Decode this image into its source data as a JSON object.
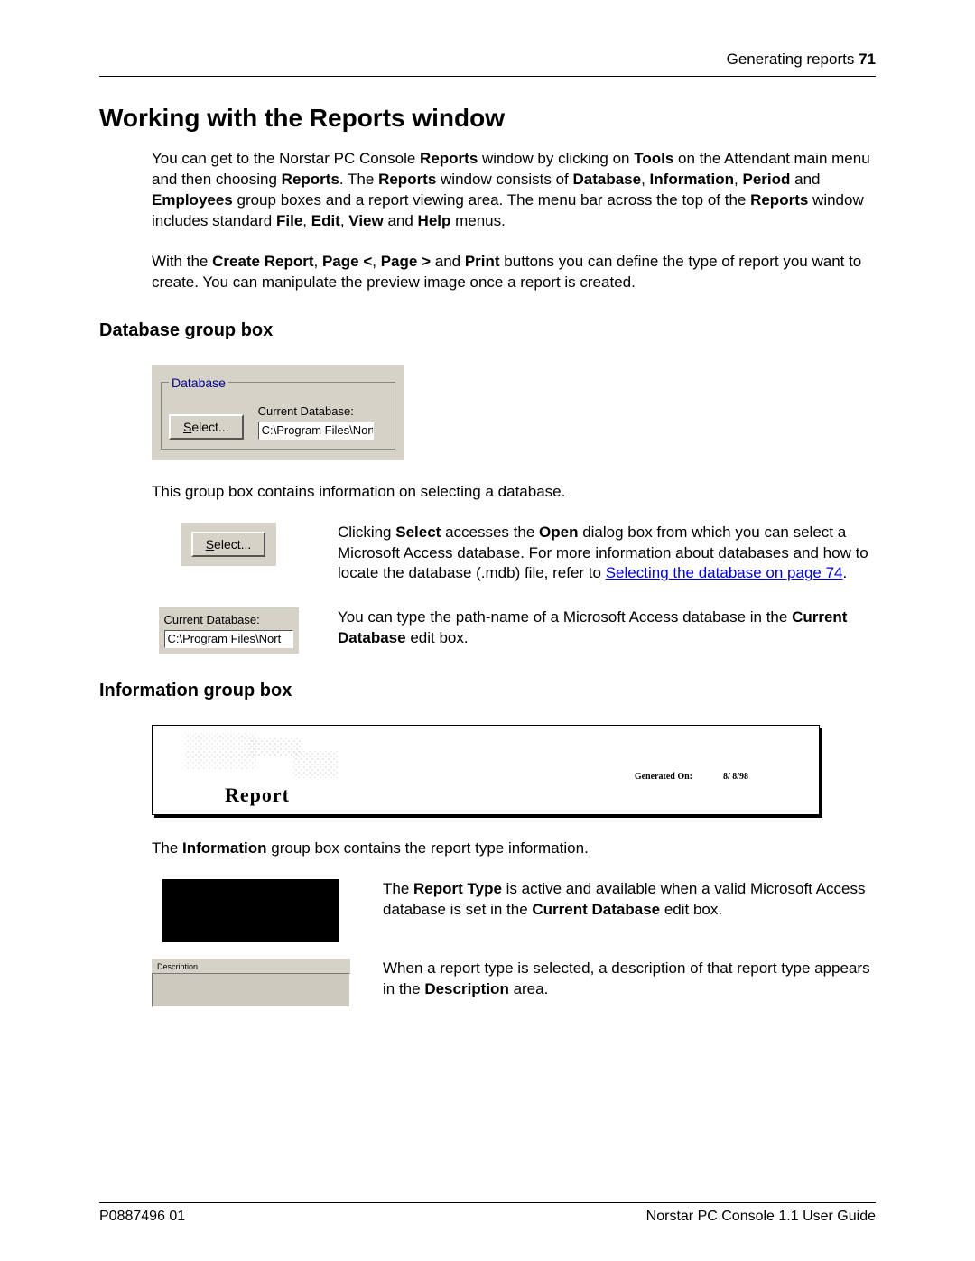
{
  "header": {
    "section": "Generating reports",
    "page": "71"
  },
  "title": "Working with the Reports window",
  "intro": {
    "p1_a": "You can get to the Norstar PC Console ",
    "p1_reports": "Reports",
    "p1_b": " window by clicking on ",
    "p1_tools": "Tools",
    "p1_c": " on the Attendant main menu and then choosing ",
    "p1_reports2": "Reports",
    "p1_d": ". The ",
    "p1_reports3": "Reports",
    "p1_e": " window consists of ",
    "p1_database": "Database",
    "p1_f": ", ",
    "p1_information": "Information",
    "p1_g": ", ",
    "p1_period": "Period",
    "p1_h": " and ",
    "p1_employees": "Employees",
    "p1_i": " group boxes and a report viewing area. The menu bar across the top of the ",
    "p1_reports4": "Reports",
    "p1_j": " window includes standard ",
    "p1_file": "File",
    "p1_k": ", ",
    "p1_edit": "Edit",
    "p1_l": ", ",
    "p1_view": "View",
    "p1_m": " and ",
    "p1_help": "Help",
    "p1_n": " menus.",
    "p2_a": "With the ",
    "p2_create": "Create Report",
    "p2_b": ", ",
    "p2_pagelt": "Page <",
    "p2_c": ", ",
    "p2_pagegt": "Page >",
    "p2_d": " and ",
    "p2_print": "Print",
    "p2_e": " buttons you can define the type of report you want to create. You can manipulate the preview image once a report is created."
  },
  "db_section": {
    "heading": "Database group box",
    "legend": "Database",
    "cur_label": "Current Database:",
    "select_btn_rest": "elect...",
    "select_prefix": "S",
    "path": "C:\\Program Files\\Nort",
    "caption": "This group box contains information on selecting a database.",
    "select_desc_a": "Clicking ",
    "select_desc_b": "Select",
    "select_desc_c": " accesses the ",
    "select_desc_d": "Open",
    "select_desc_e": " dialog box from which you can select a Microsoft Access database. For more information about databases and how to locate the database (.mdb) file, refer to ",
    "select_link": "Selecting the database on page 74",
    "select_desc_f": ".",
    "curdb_desc_a": "You can type the path-name of a Microsoft Access database in the ",
    "curdb_desc_b": "Current Database",
    "curdb_desc_c": " edit box."
  },
  "info_section": {
    "heading": "Information group box",
    "report_label": "Report",
    "gen_label": "Generated On:",
    "gen_date": "8/ 8/98",
    "caption_a": "The ",
    "caption_b": "Information",
    "caption_c": " group box contains the report type information.",
    "rtype_a": "The ",
    "rtype_b": "Report Type",
    "rtype_c": " is active and available when a valid Microsoft Access database is set in the ",
    "rtype_d": "Current Database",
    "rtype_e": " edit box.",
    "desc_label": "Description",
    "desc_a": "When a report type is selected, a description of that report type appears in the ",
    "desc_b": "Description",
    "desc_c": " area."
  },
  "footer": {
    "left": "P0887496 01",
    "right": "Norstar PC Console 1.1 User Guide"
  }
}
